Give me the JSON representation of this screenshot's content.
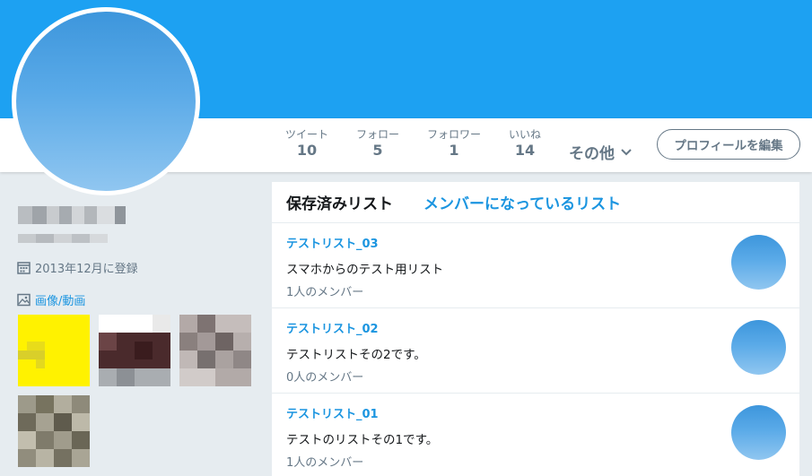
{
  "colors": {
    "banner": "#1da1f2",
    "accent": "#1b95e0",
    "muted": "#657786",
    "background": "#e6ecf0"
  },
  "profile": {
    "joined": "2013年12月に登録",
    "media_label": "画像/動画"
  },
  "stats": [
    {
      "label": "ツイート",
      "value": "10"
    },
    {
      "label": "フォロー",
      "value": "5"
    },
    {
      "label": "フォロワー",
      "value": "1"
    },
    {
      "label": "いいね",
      "value": "14"
    }
  ],
  "nav": {
    "more_label": "その他",
    "edit_profile_label": "プロフィールを編集"
  },
  "lists_panel": {
    "tabs": [
      {
        "label": "保存済みリスト",
        "active": true
      },
      {
        "label": "メンバーになっているリスト",
        "active": false
      }
    ],
    "items": [
      {
        "name": "テストリスト_03",
        "description": "スマホからのテスト用リスト",
        "members": "1人のメンバー"
      },
      {
        "name": "テストリスト_02",
        "description": "テストリストその2です。",
        "members": "0人のメンバー"
      },
      {
        "name": "テストリスト_01",
        "description": "テストのリストその1です。",
        "members": "1人のメンバー"
      }
    ]
  },
  "icons": {
    "joined": "calendar-icon",
    "media": "image-icon",
    "more": "chevron-down-icon"
  }
}
